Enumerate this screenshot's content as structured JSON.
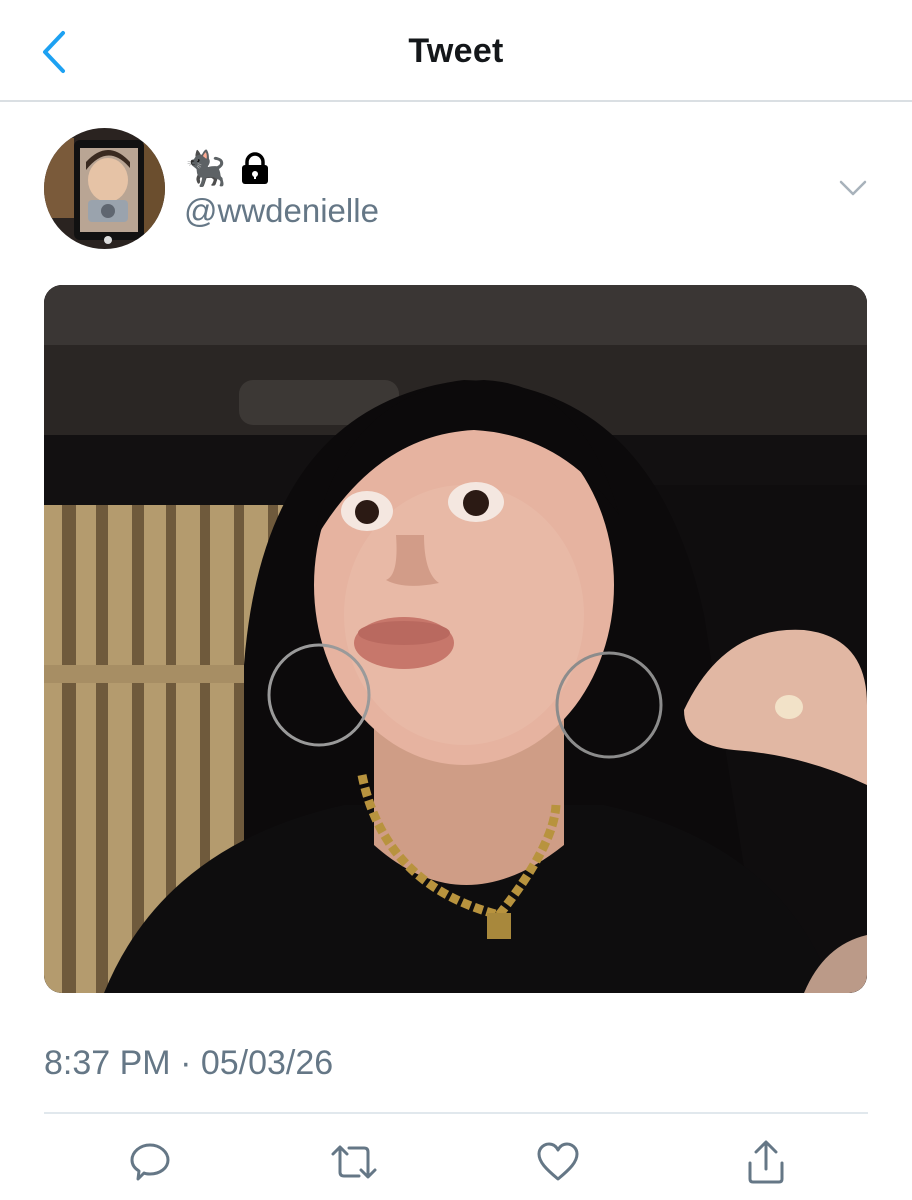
{
  "header": {
    "title": "Tweet",
    "back_icon": "chevron-left-icon",
    "accent_color": "#1da1f2"
  },
  "author": {
    "display_name": "🐈‍⬛",
    "protected_icon": "lock-icon",
    "handle": "@wwdenielle",
    "more_icon": "chevron-down-icon"
  },
  "tweet": {
    "timestamp": "8:37 PM · 05/03/26"
  },
  "actions": {
    "reply_icon": "speech-bubble-icon",
    "retweet_icon": "retweet-icon",
    "like_icon": "heart-icon",
    "share_icon": "share-icon"
  },
  "colors": {
    "text_primary": "#14171a",
    "text_secondary": "#657786",
    "divider": "#e1e8ed"
  }
}
